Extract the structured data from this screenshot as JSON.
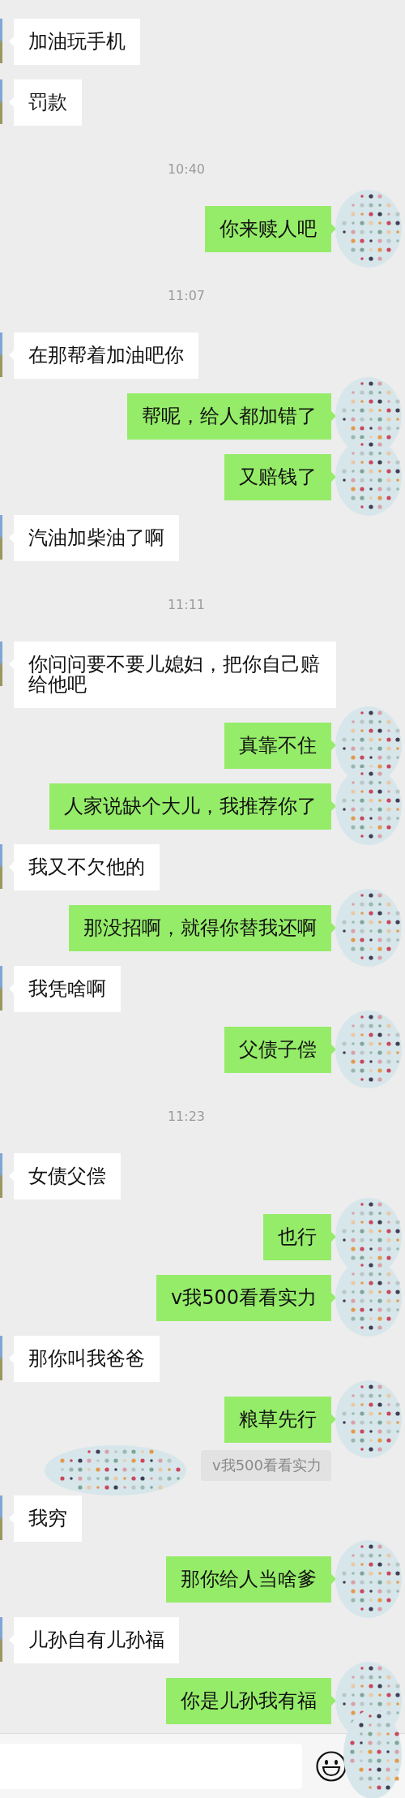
{
  "messages": [
    {
      "kind": "incoming",
      "text": "加油玩手机"
    },
    {
      "kind": "incoming",
      "text": "罚款"
    },
    {
      "kind": "time",
      "text": "10:40"
    },
    {
      "kind": "outgoing",
      "text": "你来赎人吧"
    },
    {
      "kind": "time",
      "text": "11:07"
    },
    {
      "kind": "incoming",
      "text": "在那帮着加油吧你"
    },
    {
      "kind": "outgoing",
      "text": "帮呢，给人都加错了"
    },
    {
      "kind": "outgoing",
      "text": "又赔钱了"
    },
    {
      "kind": "incoming",
      "text": "汽油加柴油了啊"
    },
    {
      "kind": "time",
      "text": "11:11"
    },
    {
      "kind": "incoming",
      "text": "你问问要不要儿媳妇，把你自己赔给他吧"
    },
    {
      "kind": "outgoing",
      "text": "真靠不住"
    },
    {
      "kind": "outgoing",
      "text": "人家说缺个大儿，我推荐你了"
    },
    {
      "kind": "incoming",
      "text": "我又不欠他的"
    },
    {
      "kind": "outgoing",
      "text": "那没招啊，就得你替我还啊"
    },
    {
      "kind": "incoming",
      "text": "我凭啥啊"
    },
    {
      "kind": "outgoing",
      "text": "父债子偿"
    },
    {
      "kind": "time",
      "text": "11:23"
    },
    {
      "kind": "incoming",
      "text": "女债父偿"
    },
    {
      "kind": "outgoing",
      "text": "也行"
    },
    {
      "kind": "outgoing",
      "text": "v我500看看实力"
    },
    {
      "kind": "incoming",
      "text": "那你叫我爸爸"
    },
    {
      "kind": "outgoing",
      "text": "粮草先行"
    },
    {
      "kind": "quote",
      "text": "v我500看看实力"
    },
    {
      "kind": "incoming",
      "text": "我穷"
    },
    {
      "kind": "outgoing",
      "text": "那你给人当啥爹"
    },
    {
      "kind": "incoming",
      "text": "儿孙自有儿孙福"
    },
    {
      "kind": "outgoing",
      "text": "你是儿孙我有福"
    }
  ]
}
